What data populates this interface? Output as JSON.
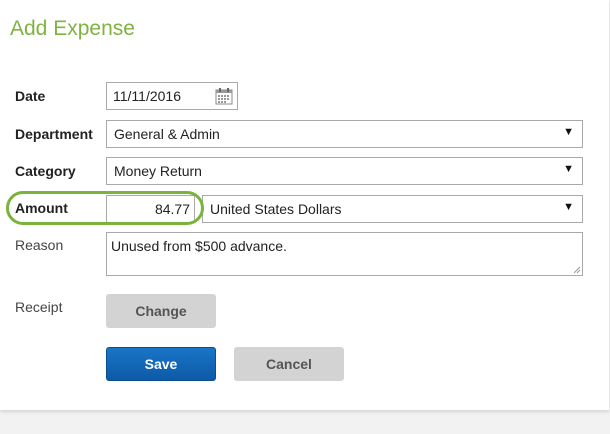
{
  "form": {
    "title": "Add Expense",
    "date": {
      "label": "Date",
      "value": "11/11/2016"
    },
    "department": {
      "label": "Department",
      "value": "General & Admin"
    },
    "category": {
      "label": "Category",
      "value": "Money Return"
    },
    "amount": {
      "label": "Amount",
      "value": "84.77",
      "currency": "United States Dollars"
    },
    "reason": {
      "label": "Reason",
      "value": "Unused from $500 advance."
    },
    "receipt": {
      "label": "Receipt",
      "change_label": "Change"
    },
    "actions": {
      "save_label": "Save",
      "cancel_label": "Cancel"
    }
  },
  "icons": {
    "calendar": "calendar-icon",
    "dropdown": "chevron-down-icon"
  },
  "colors": {
    "title": "#7fb341",
    "highlight": "#7ab33b",
    "primary_button": "#1a75c6",
    "secondary_button": "#d3d3d3"
  }
}
